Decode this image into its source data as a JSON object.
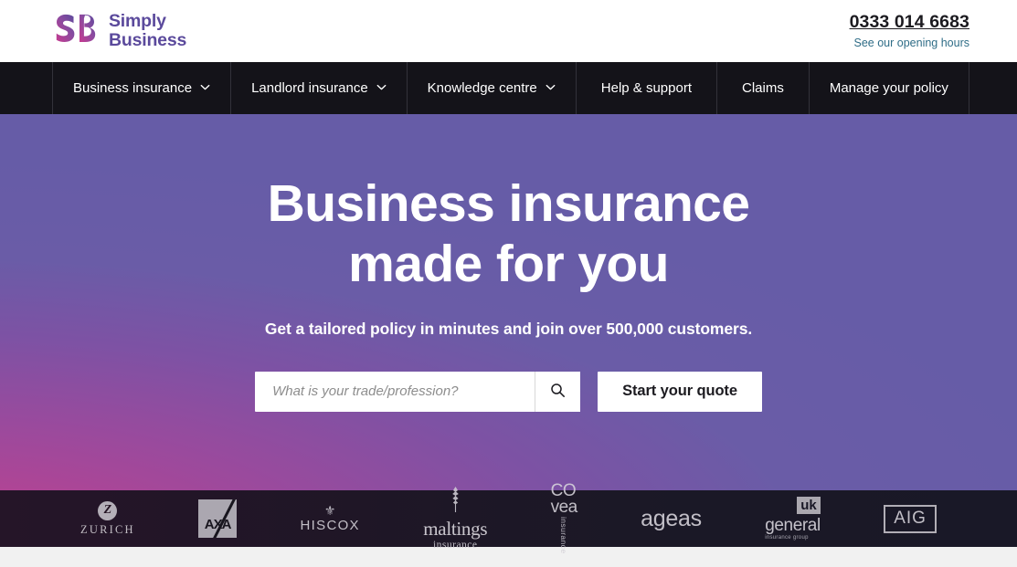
{
  "brand": {
    "mark": "SB",
    "line1": "Simply",
    "line2": "Business"
  },
  "contact": {
    "phone": "0333 014 6683",
    "hours_link": "See our opening hours"
  },
  "nav": {
    "items": [
      {
        "label": "Business insurance",
        "has_chevron": true
      },
      {
        "label": "Landlord insurance",
        "has_chevron": true
      },
      {
        "label": "Knowledge centre",
        "has_chevron": true
      },
      {
        "label": "Help & support",
        "has_chevron": false
      },
      {
        "label": "Claims",
        "has_chevron": false
      },
      {
        "label": "Manage your policy",
        "has_chevron": false
      }
    ]
  },
  "hero": {
    "heading_line1": "Business insurance",
    "heading_line2": "made for you",
    "subheading": "Get a tailored policy in minutes and join over 500,000 customers.",
    "search_placeholder": "What is your trade/profession?",
    "search_value": "",
    "search_icon": "search-icon",
    "cta_label": "Start your quote",
    "gradient_from": "#c2458f",
    "gradient_to": "#665ca7"
  },
  "partners": {
    "logos": [
      {
        "name": "Zurich",
        "mark": "Z",
        "text": "ZURICH"
      },
      {
        "name": "AXA",
        "text": "AXA"
      },
      {
        "name": "Hiscox",
        "text": "HISCOX",
        "fleur": "⚜"
      },
      {
        "name": "Maltings insurance",
        "text_main": "maltings",
        "text_sub": "insurance",
        "wheat": "ᴐ"
      },
      {
        "name": "Covea insurance",
        "text_top": "CO",
        "text_bottom": "vea",
        "text_vertical": "insurance"
      },
      {
        "name": "Ageas",
        "text": "ageas"
      },
      {
        "name": "UK General insurance group",
        "badge": "uk",
        "text_main": "general",
        "text_sub": "insurance group"
      },
      {
        "name": "AIG",
        "text": "AIG"
      }
    ],
    "bar_color": "#191827"
  }
}
